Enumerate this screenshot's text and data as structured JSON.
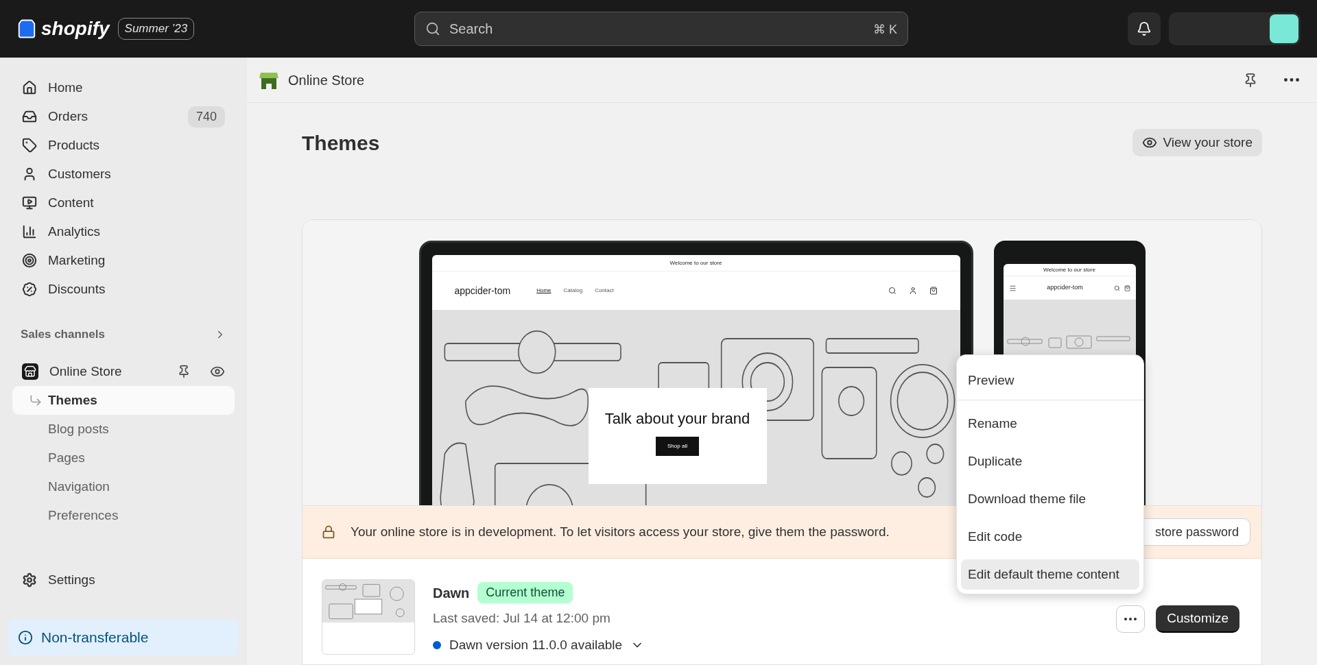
{
  "topbar": {
    "logo": "shopify",
    "release_badge": "Summer ’23",
    "search": {
      "placeholder": "Search",
      "shortcut": "⌘ K"
    }
  },
  "sidebar": {
    "items": [
      {
        "label": "Home",
        "selected": false
      },
      {
        "label": "Orders",
        "badge": "740",
        "selected": false
      },
      {
        "label": "Products",
        "selected": false
      },
      {
        "label": "Customers",
        "selected": false
      },
      {
        "label": "Content",
        "selected": false
      },
      {
        "label": "Analytics",
        "selected": false
      },
      {
        "label": "Marketing",
        "selected": false
      },
      {
        "label": "Discounts",
        "selected": false
      }
    ],
    "sales_channels": "Sales channels",
    "channel": {
      "name": "Online Store",
      "subitems": [
        {
          "label": "Themes",
          "selected": true
        },
        {
          "label": "Blog posts",
          "selected": false
        },
        {
          "label": "Pages",
          "selected": false
        },
        {
          "label": "Navigation",
          "selected": false
        },
        {
          "label": "Preferences",
          "selected": false
        }
      ]
    },
    "settings": "Settings",
    "plan_notice": "Non-transferable"
  },
  "header": {
    "title": "Online Store"
  },
  "page": {
    "title": "Themes",
    "view_store": "View your store"
  },
  "preview": {
    "desktop": {
      "announcement": "Welcome to our store",
      "store_name": "appcider-tom",
      "nav": [
        {
          "label": "Home",
          "selected": true
        },
        {
          "label": "Catalog",
          "selected": false
        },
        {
          "label": "Contact",
          "selected": false
        }
      ],
      "hero_title": "Talk about your brand",
      "hero_button": "Shop all"
    },
    "mobile": {
      "announcement": "Welcome to our store",
      "store_name": "appcider-tom"
    }
  },
  "banner": {
    "text": "Your online store is in development. To let visitors access your store, give them the password.",
    "button": "store password"
  },
  "theme": {
    "name": "Dawn",
    "badge": "Current theme",
    "last_saved": "Last saved: Jul 14 at 12:00 pm",
    "update": "Dawn version 11.0.0 available",
    "customize": "Customize"
  },
  "menu": {
    "items": [
      {
        "label": "Preview",
        "highlighted": false,
        "divider_after": true
      },
      {
        "label": "Rename",
        "highlighted": false,
        "divider_after": false
      },
      {
        "label": "Duplicate",
        "highlighted": false,
        "divider_after": false
      },
      {
        "label": "Download theme file",
        "highlighted": false,
        "divider_after": false
      },
      {
        "label": "Edit code",
        "highlighted": false,
        "divider_after": false
      },
      {
        "label": "Edit default theme content",
        "highlighted": true,
        "divider_after": false
      }
    ]
  }
}
